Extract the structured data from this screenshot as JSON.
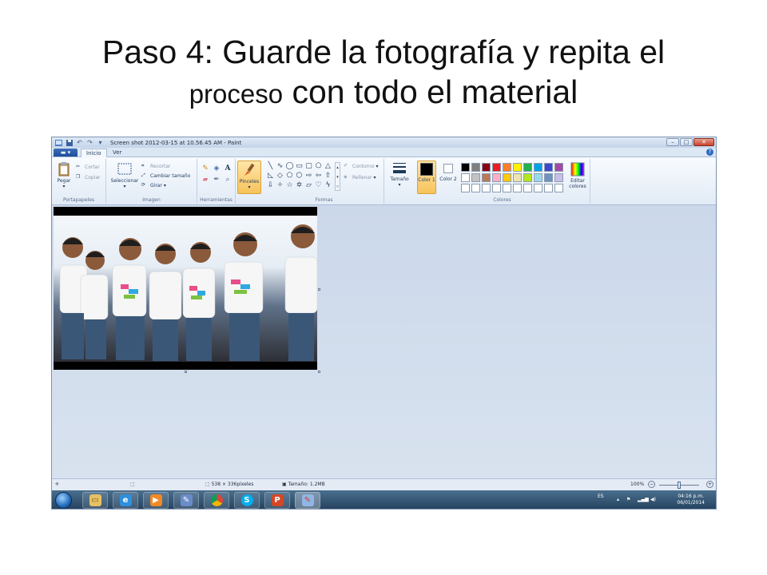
{
  "slide": {
    "title_line1": "Paso 4: Guarde la fotografía y repita el",
    "title_line2_small": "proceso",
    "title_line2_big": " con todo el material"
  },
  "window": {
    "title": "Screen shot 2012-03-15 at 10.56.45 AM - Paint",
    "quick_access_icons": [
      "paint-app-icon",
      "save-icon",
      "undo-icon",
      "redo-icon",
      "customize-icon"
    ],
    "controls": [
      "minimize",
      "maximize",
      "close"
    ]
  },
  "ribbon": {
    "file_menu": "",
    "tabs": [
      "Inicio",
      "Ver"
    ],
    "active_tab": "Inicio",
    "portapapeles": {
      "label": "Portapapeles",
      "paste": "Pegar",
      "cut": "Cortar",
      "copy": "Copiar"
    },
    "imagen": {
      "label": "Imagen",
      "select": "Seleccionar",
      "crop": "Recortar",
      "resize": "Cambiar tamaño",
      "rotate": "Girar"
    },
    "herramientas": {
      "label": "Herramientas"
    },
    "brushes": "Pinceles",
    "formas": {
      "label": "Formas",
      "outline": "Contorno",
      "fill": "Rellenar"
    },
    "size": "Tamaño",
    "colores": {
      "label": "Colores",
      "color1": "Color 1",
      "color2": "Color 2",
      "edit": "Editar colores",
      "color1_value": "#000000",
      "color2_value": "#ffffff",
      "palette_row1": [
        "#000000",
        "#7f7f7f",
        "#880015",
        "#ed1c24",
        "#ff7f27",
        "#fff200",
        "#22b14c",
        "#00a2e8",
        "#3f48cc",
        "#a349a4"
      ],
      "palette_row2": [
        "#ffffff",
        "#c3c3c3",
        "#b97a57",
        "#ffaec9",
        "#ffc90e",
        "#efe4b0",
        "#b5e61d",
        "#99d9ea",
        "#7092be",
        "#c8bfe7"
      ],
      "palette_row3": [
        "#ffffff",
        "#ffffff",
        "#ffffff",
        "#ffffff",
        "#ffffff",
        "#ffffff",
        "#ffffff",
        "#ffffff",
        "#ffffff",
        "#ffffff"
      ]
    }
  },
  "status": {
    "dimensions": "538 × 336píxeles",
    "file_size": "Tamaño: 1.2MB",
    "zoom": "100%"
  },
  "taskbar": {
    "apps": [
      "file-explorer",
      "internet-explorer",
      "media-player",
      "paint-brush",
      "chrome",
      "skype",
      "powerpoint",
      "paint"
    ],
    "language": "ES",
    "time": "04:16 p.m.",
    "date": "06/01/2014"
  }
}
